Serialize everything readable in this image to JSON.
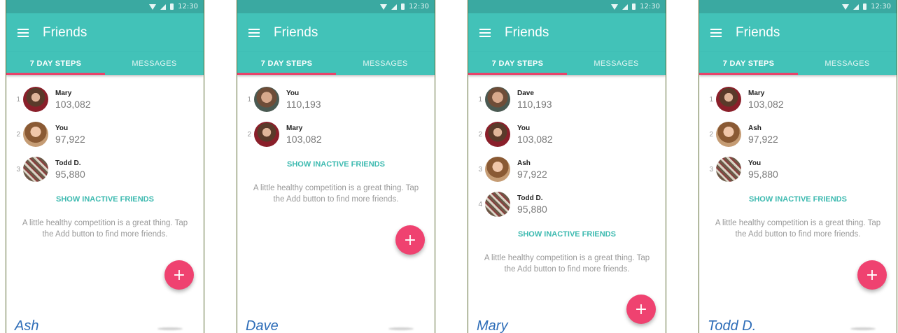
{
  "status_time": "12:30",
  "app_title": "Friends",
  "tabs": [
    "7 DAY STEPS",
    "MESSAGES"
  ],
  "show_inactive_label": "SHOW INACTIVE FRIENDS",
  "tip_text": "A little healthy competition is a great thing. Tap the Add button to find more friends.",
  "fab_label": "+",
  "colors": {
    "accent": "#42c2b8",
    "fab": "#ef4270",
    "tab_indicator": "#e8436a",
    "caption": "#2e6db8"
  },
  "screens": [
    {
      "caption": "Ash",
      "friends": [
        {
          "rank": "1",
          "name": "Mary",
          "steps": "103,082",
          "avatar": "av-mary"
        },
        {
          "rank": "2",
          "name": "You",
          "steps": "97,922",
          "avatar": "av-ash"
        },
        {
          "rank": "3",
          "name": "Todd D.",
          "steps": "95,880",
          "avatar": "av-todd"
        }
      ]
    },
    {
      "caption": "Dave",
      "friends": [
        {
          "rank": "1",
          "name": "You",
          "steps": "110,193",
          "avatar": "av-dave"
        },
        {
          "rank": "2",
          "name": "Mary",
          "steps": "103,082",
          "avatar": "av-mary"
        }
      ]
    },
    {
      "caption": "Mary",
      "friends": [
        {
          "rank": "1",
          "name": "Dave",
          "steps": "110,193",
          "avatar": "av-dave"
        },
        {
          "rank": "2",
          "name": "You",
          "steps": "103,082",
          "avatar": "av-mary"
        },
        {
          "rank": "3",
          "name": "Ash",
          "steps": "97,922",
          "avatar": "av-ash"
        },
        {
          "rank": "4",
          "name": "Todd D.",
          "steps": "95,880",
          "avatar": "av-todd"
        }
      ]
    },
    {
      "caption": "Todd D.",
      "friends": [
        {
          "rank": "1",
          "name": "Mary",
          "steps": "103,082",
          "avatar": "av-mary"
        },
        {
          "rank": "2",
          "name": "Ash",
          "steps": "97,922",
          "avatar": "av-ash"
        },
        {
          "rank": "3",
          "name": "You",
          "steps": "95,880",
          "avatar": "av-todd"
        }
      ]
    }
  ]
}
